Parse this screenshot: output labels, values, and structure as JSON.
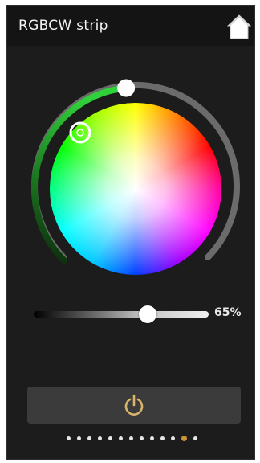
{
  "header": {
    "title": "RGBCW strip",
    "home_icon": "home-icon"
  },
  "color_wheel": {
    "selected_hue_marker_icon": "color-target-icon",
    "brightness_ring_level": 0.48,
    "ring_active_color": "#2ecc40"
  },
  "brightness": {
    "value_percent": 65,
    "label": "65%"
  },
  "power": {
    "icon": "power-icon",
    "icon_color": "#d9b56b"
  },
  "pager": {
    "page_count": 13,
    "active_index": 11
  }
}
